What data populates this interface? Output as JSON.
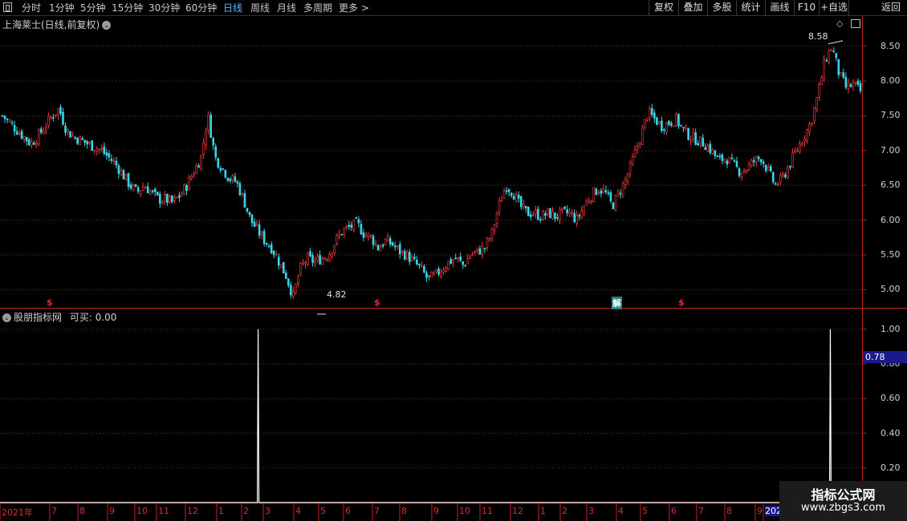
{
  "toolbar": {
    "periods": [
      "分时",
      "1分钟",
      "5分钟",
      "15分钟",
      "30分钟",
      "60分钟",
      "日线",
      "周线",
      "月线",
      "多周期",
      "更多 >"
    ],
    "active_period": "日线",
    "buttons": [
      "复权",
      "叠加",
      "多股",
      "统计",
      "画线",
      "F10",
      "+自选",
      "返回"
    ]
  },
  "main_panel": {
    "title": "上海莱士(日线,前复权)",
    "price_axis": [
      "8.50",
      "8.00",
      "7.50",
      "7.00",
      "6.50",
      "6.00",
      "5.50",
      "5.00"
    ],
    "high_label": "8.58",
    "low_label": "4.82",
    "markers": [
      "$",
      "$",
      "解",
      "$"
    ]
  },
  "indicator_panel": {
    "title": "股朋指标网",
    "value_label": "可买: 0.00",
    "axis": [
      "1.00",
      "0.80",
      "0.60",
      "0.40",
      "0.20"
    ],
    "current_value": "0.78"
  },
  "date_axis": [
    "2021年",
    "7",
    "8",
    "9",
    "10",
    "11",
    "12",
    "1",
    "2",
    "3",
    "4",
    "5",
    "6",
    "7",
    "8",
    "9",
    "10",
    "11",
    "12",
    "1",
    "2",
    "3",
    "4",
    "5",
    "6",
    "7",
    "8",
    "9",
    "202"
  ],
  "watermark": {
    "line1": "指标公式网",
    "line2": "www.zbgs3.com"
  },
  "colors": {
    "up": "#ff3b3b",
    "down": "#36d7e6",
    "grid": "#8b1a1a",
    "axis": "#c81e1e",
    "indicator_line": "#ffffff"
  },
  "chart_data": [
    {
      "type": "candlestick",
      "title": "上海莱士(日线,前复权)",
      "ylim": [
        4.75,
        8.75
      ],
      "ticks": [
        5.0,
        5.5,
        6.0,
        6.5,
        7.0,
        7.5,
        8.0,
        8.5
      ],
      "annotations": [
        {
          "label": "8.58",
          "value": 8.58
        },
        {
          "label": "4.82",
          "value": 4.82
        }
      ],
      "close_trend": [
        7.5,
        7.4,
        7.3,
        7.2,
        7.1,
        7.2,
        7.35,
        7.5,
        7.6,
        7.3,
        7.2,
        7.15,
        7.1,
        7.05,
        7.0,
        6.9,
        6.8,
        6.65,
        6.5,
        6.4,
        6.5,
        6.4,
        6.3,
        6.3,
        6.25,
        6.35,
        6.5,
        6.7,
        6.9,
        7.5,
        6.9,
        6.75,
        6.6,
        6.55,
        6.3,
        6.0,
        5.85,
        5.7,
        5.6,
        5.4,
        5.2,
        4.9,
        5.3,
        5.45,
        5.4,
        5.45,
        5.5,
        5.7,
        5.85,
        5.9,
        5.95,
        5.8,
        5.75,
        5.6,
        5.7,
        5.65,
        5.55,
        5.5,
        5.4,
        5.3,
        5.15,
        5.2,
        5.3,
        5.4,
        5.45,
        5.35,
        5.5,
        5.55,
        5.6,
        5.8,
        6.2,
        6.5,
        6.4,
        6.2,
        6.1,
        6.1,
        6.05,
        6.1,
        6.05,
        6.1,
        6.1,
        6.0,
        6.2,
        6.35,
        6.45,
        6.4,
        6.2,
        6.4,
        6.6,
        6.9,
        7.2,
        7.55,
        7.45,
        7.35,
        7.4,
        7.45,
        7.3,
        7.2,
        7.15,
        7.1,
        7.0,
        6.85,
        6.9,
        6.8,
        6.7,
        6.75,
        6.85,
        6.9,
        6.7,
        6.5,
        6.6,
        6.8,
        7.0,
        7.2,
        7.4,
        7.8,
        8.3,
        8.5,
        8.1,
        7.9,
        7.95,
        7.85
      ]
    },
    {
      "type": "line",
      "title": "股朋指标网",
      "ylim": [
        0,
        1.05
      ],
      "ticks": [
        0.2,
        0.4,
        0.6,
        0.8,
        1.0
      ],
      "series": [
        {
          "name": "可买",
          "spikes": [
            {
              "position": 0.3,
              "value": 1.0
            },
            {
              "position": 0.965,
              "value": 1.0
            }
          ],
          "baseline": 0.0
        }
      ]
    }
  ]
}
